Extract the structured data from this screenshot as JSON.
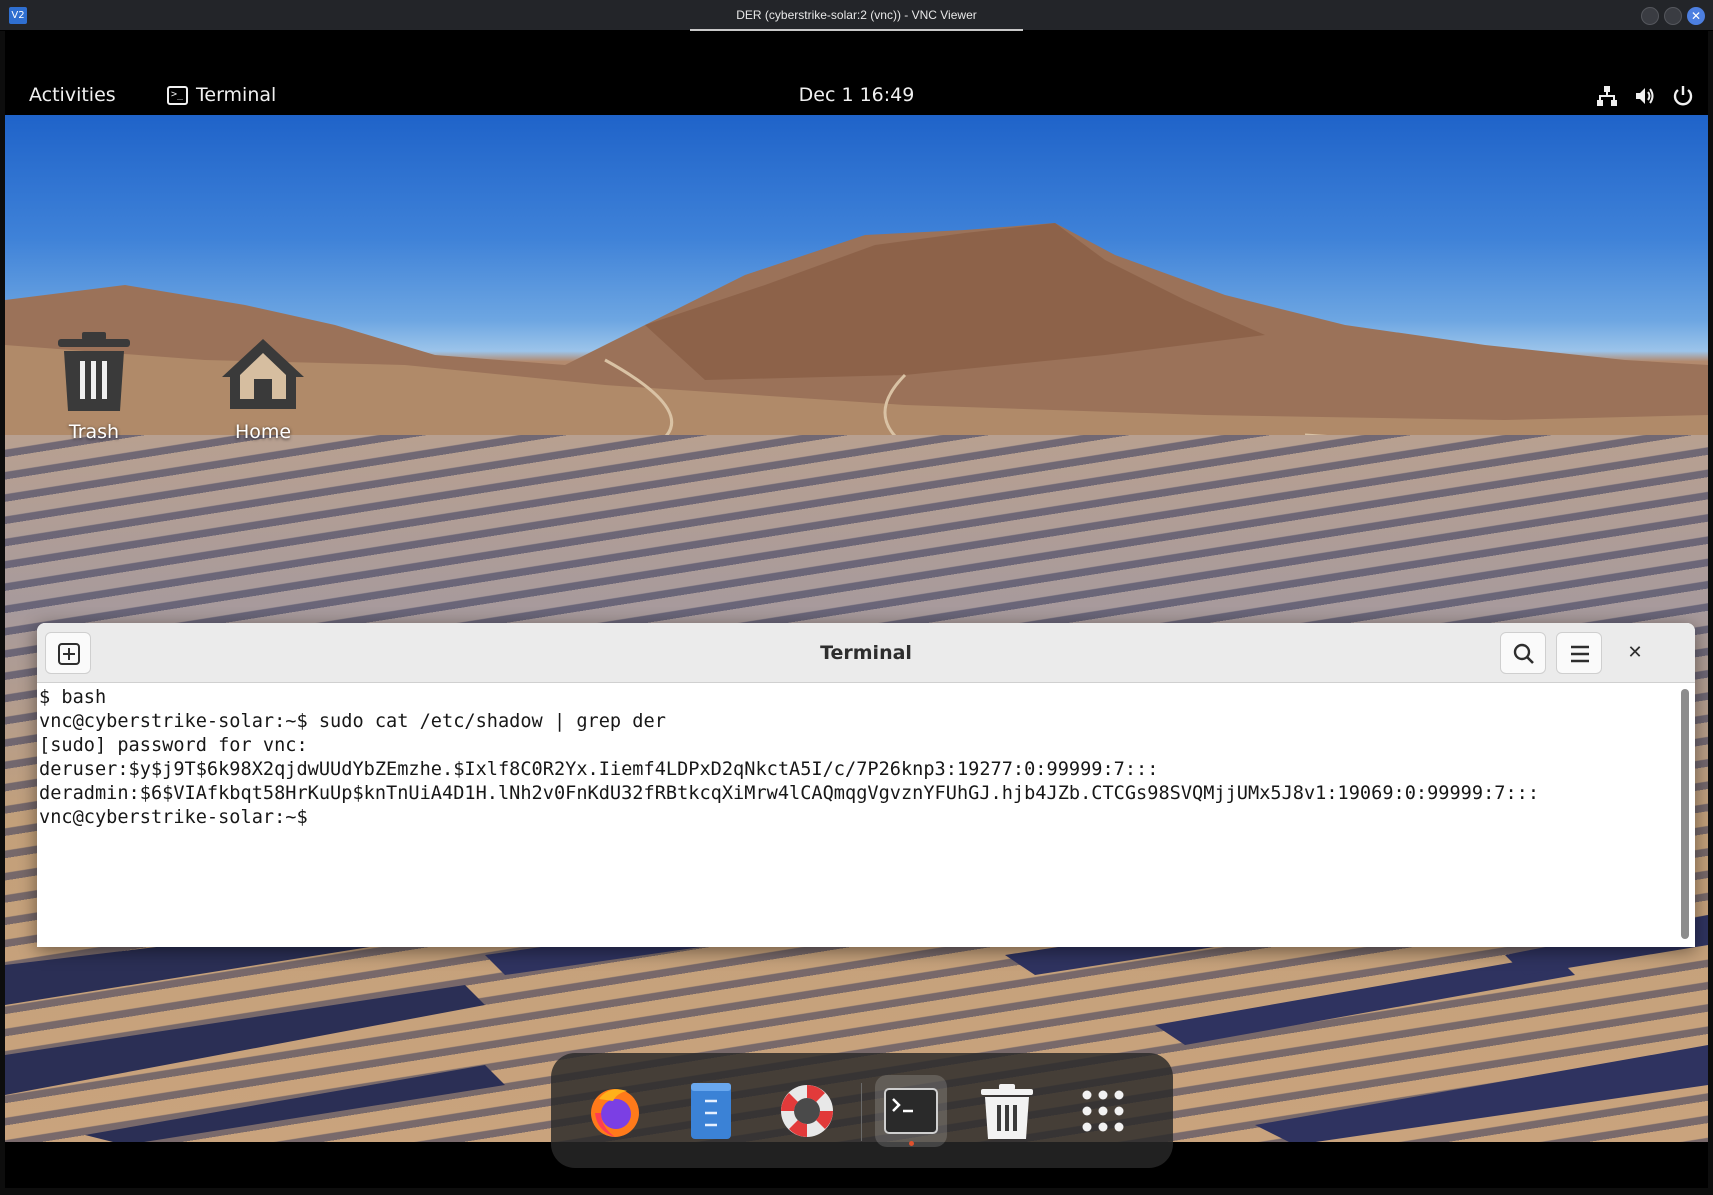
{
  "vnc_window": {
    "title": "DER (cyberstrike-solar:2 (vnc)) - VNC Viewer",
    "app_icon_label": "V2"
  },
  "top_bar": {
    "activities": "Activities",
    "app_name": "Terminal",
    "clock": "Dec 1  16:49",
    "tray_icons": [
      "network-icon",
      "volume-icon",
      "power-icon"
    ]
  },
  "desktop_icons": [
    {
      "label": "Trash",
      "icon": "trash-icon"
    },
    {
      "label": "Home",
      "icon": "home-icon"
    }
  ],
  "terminal": {
    "title": "Terminal",
    "lines": [
      "$ bash",
      "vnc@cyberstrike-solar:~$ sudo cat /etc/shadow | grep der",
      "[sudo] password for vnc:",
      "deruser:$y$j9T$6k98X2qjdwUUdYbZEmzhe.$Ixlf8C0R2Yx.Iiemf4LDPxD2qNkctA5I/c/7P26knp3:19277:0:99999:7:::",
      "deradmin:$6$VIAfkbqt58HrKuUp$knTnUiA4D1H.lNh2v0FnKdU32fRBtkcqXiMrw4lCAQmqgVgvznYFUhGJ.hjb4JZb.CTCGs98SVQMjjUMx5J8v1:19069:0:99999:7:::",
      "vnc@cyberstrike-solar:~$ "
    ]
  },
  "dock": {
    "items": [
      "firefox-icon",
      "files-icon",
      "help-icon",
      "terminal-icon",
      "trash-icon",
      "app-grid-icon"
    ],
    "running": "terminal-icon"
  },
  "colors": {
    "panel_bg": "#000000",
    "terminal_header": "#ebebeb",
    "running_indicator": "#e0512d"
  }
}
